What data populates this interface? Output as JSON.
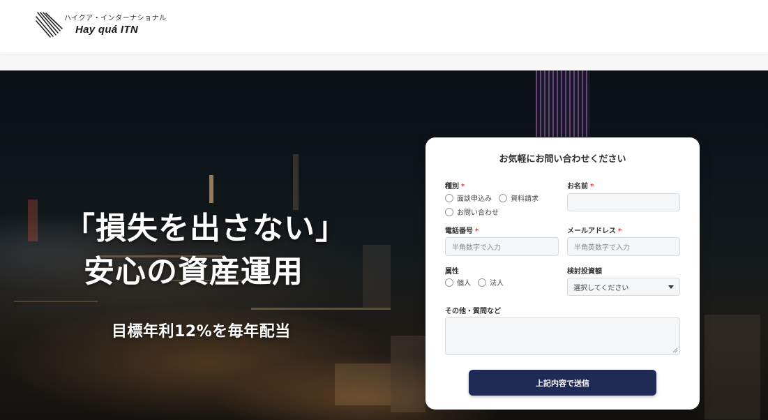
{
  "header": {
    "logo_sub": "ハイクア・インターナショナル",
    "logo_main": "Hay quá ITN"
  },
  "hero": {
    "title_line1": "「損失を出さない」",
    "title_line2": "安心の資産運用",
    "subtitle": "目標年利12%を毎年配当"
  },
  "form": {
    "title": "お気軽にお問い合わせください",
    "type": {
      "label": "種別",
      "required_mark": "*",
      "options": [
        "面談申込み",
        "資料請求",
        "お問い合わせ"
      ]
    },
    "name": {
      "label": "お名前",
      "required_mark": "*",
      "value": ""
    },
    "phone": {
      "label": "電話番号",
      "required_mark": "*",
      "placeholder": "半角数字で入力"
    },
    "email": {
      "label": "メールアドレス",
      "required_mark": "*",
      "placeholder": "半角英数字で入力"
    },
    "attribute": {
      "label": "属性",
      "options": [
        "個人",
        "法人"
      ]
    },
    "investment": {
      "label": "検討投資額",
      "selected": "選択してください"
    },
    "other": {
      "label": "その他・質問など"
    },
    "submit_label": "上記内容で送信"
  },
  "colors": {
    "submit_bg": "#1f2a55",
    "required": "#e53935"
  }
}
